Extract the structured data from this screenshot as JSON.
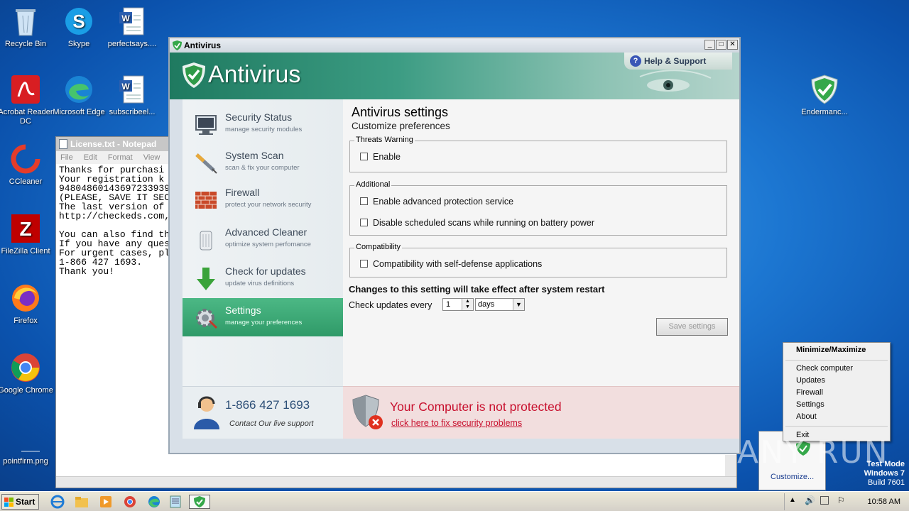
{
  "desktop": {
    "icons": [
      {
        "label": "Recycle Bin"
      },
      {
        "label": "Skype"
      },
      {
        "label": "perfectsays...."
      },
      {
        "label": "Acrobat Reader DC"
      },
      {
        "label": "Microsoft Edge"
      },
      {
        "label": "subscribeel..."
      },
      {
        "label": "CCleaner"
      },
      {
        "label": "FileZilla Client"
      },
      {
        "label": "Firefox"
      },
      {
        "label": "Google Chrome"
      },
      {
        "label": "pointfirm.png"
      },
      {
        "label": "Endermanc..."
      }
    ]
  },
  "notepad": {
    "title": "License.txt - Notepad",
    "menu": [
      "File",
      "Edit",
      "Format",
      "View",
      "He"
    ],
    "text": "Thanks for purchasi\nYour registration k\n94804860143697233939\n(PLEASE, SAVE IT SEC\nThe last version of\nhttp://checkeds.com,\n\nYou can also find th\nIf you have any ques\nFor urgent cases, pl\n1-866 427 1693.\nThank you!"
  },
  "antivirus": {
    "window_title": "Antivirus",
    "brand": "Antivirus",
    "help_label": "Help & Support",
    "nav": [
      {
        "title": "Security Status",
        "subtitle": "manage security modules",
        "icon": "monitor-icon"
      },
      {
        "title": "System Scan",
        "subtitle": "scan & fix your computer",
        "icon": "syringe-icon"
      },
      {
        "title": "Firewall",
        "subtitle": "protect your network security",
        "icon": "brick-wall-icon"
      },
      {
        "title": "Advanced Cleaner",
        "subtitle": "optimize system perfomance",
        "icon": "trash-can-icon"
      },
      {
        "title": "Check for updates",
        "subtitle": "update virus definitions",
        "icon": "down-arrow-icon"
      },
      {
        "title": "Settings",
        "subtitle": "manage your preferences",
        "icon": "gear-icon"
      }
    ],
    "active_nav": "Settings",
    "support_phone": "1-866 427 1693",
    "support_text": "Contact Our live support",
    "settings": {
      "heading": "Antivirus settings",
      "subheading": "Customize preferences",
      "groups": [
        {
          "label": "Threats Warning",
          "options": [
            "Enable"
          ]
        },
        {
          "label": "Additional",
          "options": [
            "Enable advanced protection service",
            "Disable scheduled scans while running on battery power"
          ]
        },
        {
          "label": "Compatibility",
          "options": [
            "Compatibility with self-defense applications"
          ]
        }
      ],
      "restart_note": "Changes to this setting will take effect after system restart",
      "check_updates_label": "Check updates every",
      "check_updates_value": "1",
      "check_updates_unit": "days",
      "save_label": "Save settings"
    },
    "alert": {
      "title": "Your Computer is not protected",
      "link": "click here to fix security problems"
    }
  },
  "context_menu": {
    "header": "Minimize/Maximize",
    "items": [
      "Check computer",
      "Updates",
      "Firewall",
      "Settings",
      "About"
    ],
    "exit": "Exit"
  },
  "tray_flyout": {
    "customize": "Customize..."
  },
  "watermark": "ANY RUN",
  "test_mode": {
    "line1": "Test Mode",
    "line2": "Windows 7",
    "line3": "Build 7601"
  },
  "taskbar": {
    "start_label": "Start",
    "clock": "10:58 AM"
  },
  "colors": {
    "accent_green": "#2f9a68",
    "alert_red": "#c8102e",
    "desktop_blue": "#1c76d1"
  }
}
